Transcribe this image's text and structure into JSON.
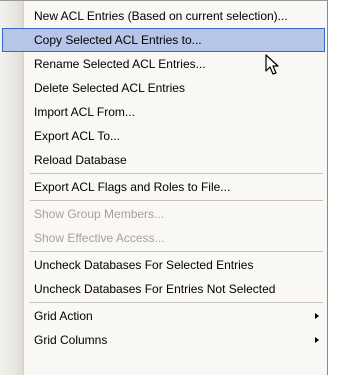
{
  "menu": {
    "items": [
      {
        "label": "New ACL Entries (Based on current selection)...",
        "state": "normal"
      },
      {
        "label": "Copy Selected ACL Entries to...",
        "state": "selected"
      },
      {
        "label": "Rename Selected  ACL Entries...",
        "state": "normal"
      },
      {
        "label": "Delete Selected ACL Entries",
        "state": "normal"
      },
      {
        "label": "Import ACL From...",
        "state": "normal"
      },
      {
        "label": "Export ACL To...",
        "state": "normal"
      },
      {
        "label": "Reload Database",
        "state": "normal"
      },
      {
        "label": "Export ACL Flags and Roles to File...",
        "state": "normal"
      },
      {
        "label": "Show Group Members...",
        "state": "disabled"
      },
      {
        "label": "Show Effective Access...",
        "state": "disabled"
      },
      {
        "label": "Uncheck Databases For Selected Entries",
        "state": "normal"
      },
      {
        "label": "Uncheck Databases For Entries Not Selected",
        "state": "normal"
      },
      {
        "label": "Grid Action",
        "state": "normal",
        "submenu": true
      },
      {
        "label": "Grid Columns",
        "state": "normal",
        "submenu": true
      }
    ]
  },
  "colors": {
    "highlight_fill": "#b6c5e8",
    "highlight_border": "#316ac5",
    "disabled_text": "#a5a29a",
    "menu_background": "#f9f8f4"
  },
  "icons": {
    "submenu": "triangle-right-icon",
    "pointer": "mouse-pointer-icon"
  }
}
